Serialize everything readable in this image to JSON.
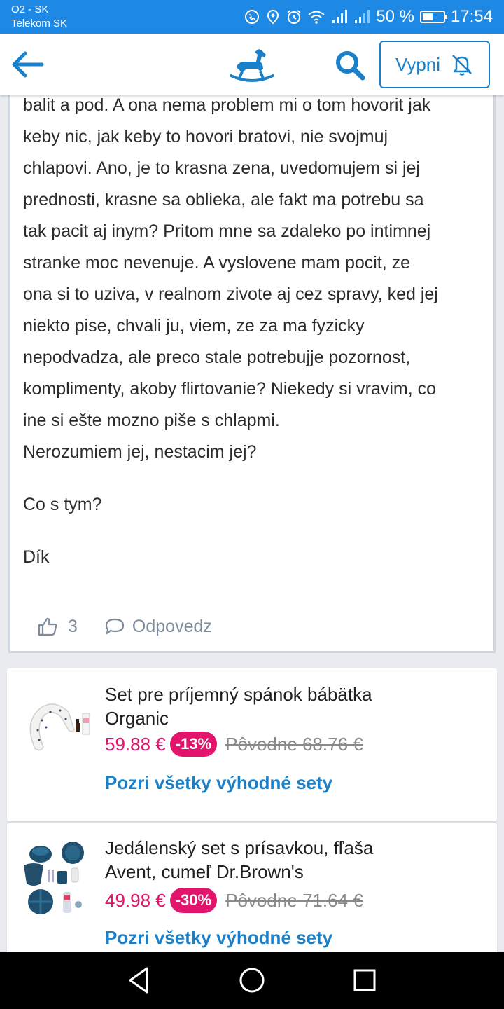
{
  "status_bar": {
    "carrier_line1": "O2 - SK",
    "carrier_line2": "Telekom SK",
    "battery": "50 %",
    "battery_level": 0.5,
    "time": "17:54",
    "icons": [
      "hd-call-icon",
      "location-icon",
      "alarm-icon",
      "wifi-icon",
      "signal-icon",
      "signal-icon",
      "battery-icon"
    ]
  },
  "app_bar": {
    "back_icon": "arrow-left-icon",
    "logo_icon": "rocking-horse-icon",
    "search_icon": "search-icon",
    "mute_label": "Vypni",
    "mute_icon": "bell-off-icon",
    "accent_color": "#1a80c9"
  },
  "post": {
    "lines": [
      "balit a pod. A ona nema problem mi o tom hovorit jak",
      "keby nic, jak keby to hovori bratovi, nie svojmuj",
      "chlapovi. Ano, je to krasna zena, uvedomujem si jej",
      "prednosti, krasne sa oblieka, ale fakt ma potrebu sa",
      "tak pacit aj inym? Pritom mne sa zdaleko po intimnej",
      "stranke moc nevenuje. A vyslovene mam pocit, ze",
      "ona si to uziva, v realnom zivote aj cez spravy, ked jej",
      "niekto pise, chvali ju, viem, ze za ma fyzicky",
      "nepodvadza, ale preco stale potrebujje pozornost,",
      "komplimenty, akoby flirtovanie? Niekedy si vravim, co",
      "ine si ešte mozno piše s chlapmi.",
      "Nerozumiem jej, nestacim jej?"
    ],
    "question": "Co s tym?",
    "closing": "Dík",
    "like_count": "3",
    "like_icon": "thumbs-up-icon",
    "reply_label": "Odpovedz",
    "reply_icon": "speech-bubble-icon"
  },
  "products": [
    {
      "title_line1": "Set pre príjemný spánok bábätka",
      "title_line2": "Organic",
      "price": "59.88 €",
      "discount": "-13%",
      "original": "Pôvodne 68.76 €",
      "link": "Pozri všetky výhodné sety",
      "image": "nursing-pillow-image"
    },
    {
      "title_line1": "Jedálenský set s prísavkou, fľaša",
      "title_line2": "Avent, cumeľ Dr.Brown's",
      "price": "49.98 €",
      "discount": "-30%",
      "original": "Pôvodne 71.64 €",
      "link": "Pozri všetky výhodné sety",
      "image": "feeding-set-image"
    }
  ],
  "nav_bar": {
    "back_icon": "triangle-back-icon",
    "home_icon": "circle-home-icon",
    "recents_icon": "square-recents-icon"
  }
}
